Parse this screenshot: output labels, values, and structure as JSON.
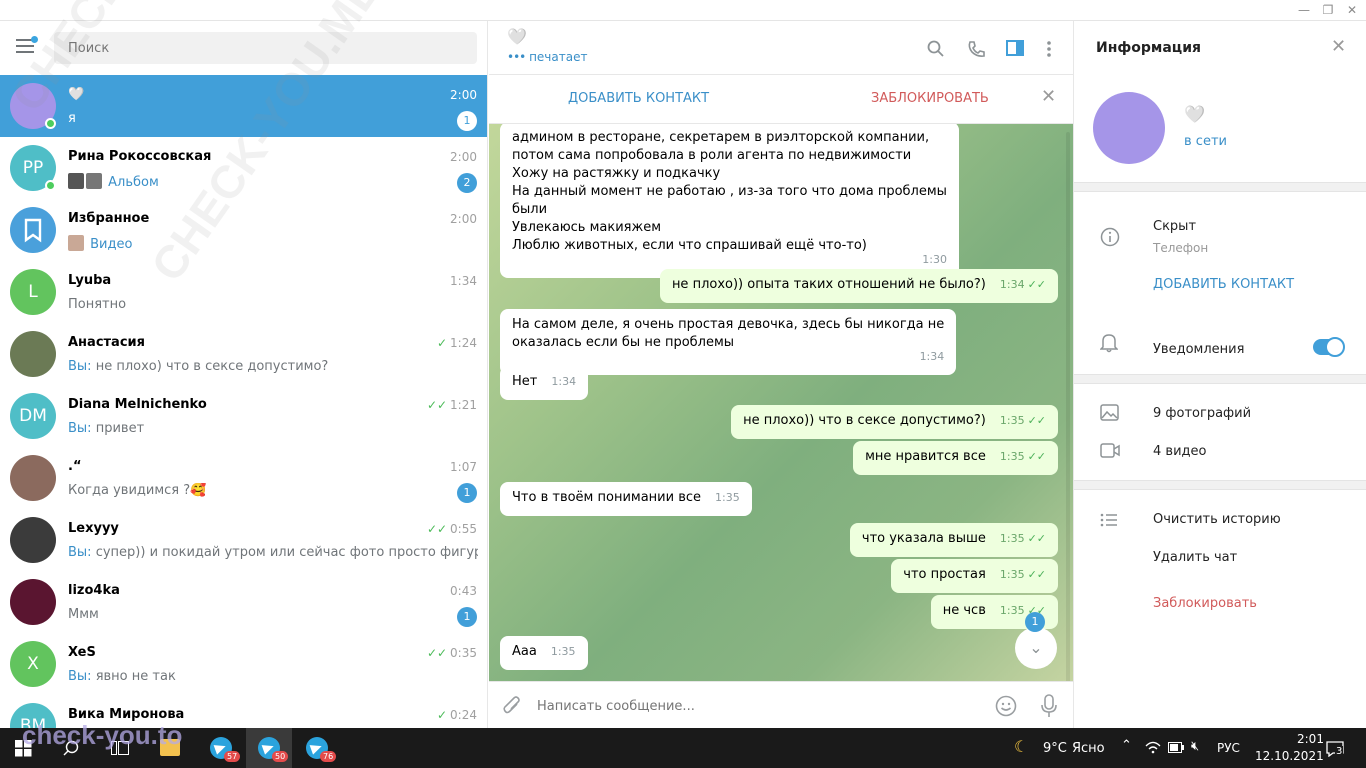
{
  "window": {
    "minimize": "—",
    "maximize": "❐",
    "close": "✕"
  },
  "search": {
    "placeholder": "Поиск"
  },
  "chats": [
    {
      "name": "🤍",
      "preview": "я",
      "time": "2:00",
      "badge": "1",
      "active": true,
      "avatar_color": "#a595e8",
      "initials": "",
      "online": true,
      "you": "",
      "media": "",
      "check": ""
    },
    {
      "name": "Рина Рокоссовская",
      "preview": "",
      "media": "Альбом",
      "time": "2:00",
      "badge": "2",
      "avatar_color": "#4fbec7",
      "initials": "РР",
      "online": true,
      "you": "",
      "check": ""
    },
    {
      "name": "Избранное",
      "preview": "",
      "media": "Видео",
      "time": "2:00",
      "badge": "",
      "avatar_color": "#4aa0db",
      "initials": "",
      "online": false,
      "you": "",
      "check": ""
    },
    {
      "name": "Lyuba",
      "preview": "Понятно",
      "time": "1:34",
      "badge": "",
      "avatar_color": "#62c45e",
      "initials": "L",
      "online": false,
      "you": "",
      "media": "",
      "check": ""
    },
    {
      "name": "Анастасия",
      "preview": "не плохо) что в сексе допустимо?",
      "you": "Вы:",
      "time": "1:24",
      "badge": "",
      "avatar_color": "#6b7a55",
      "initials": "",
      "online": false,
      "media": "",
      "check": "✓"
    },
    {
      "name": "Diana Melnichenko",
      "preview": "привет",
      "you": "Вы:",
      "time": "1:21",
      "badge": "",
      "avatar_color": "#4fbec7",
      "initials": "DM",
      "online": false,
      "media": "",
      "check": "✓✓"
    },
    {
      "name": ".“",
      "preview": "Когда увидимся ?🥰",
      "time": "1:07",
      "badge": "1",
      "avatar_color": "#8b6a5e",
      "initials": "",
      "online": false,
      "you": "",
      "media": "",
      "check": ""
    },
    {
      "name": "Lexyyy",
      "preview": "супер)) и покидай утром или сейчас фото просто фигуры, су...",
      "you": "Вы:",
      "time": "0:55",
      "badge": "",
      "avatar_color": "#3b3b3b",
      "initials": "",
      "online": false,
      "media": "",
      "check": "✓✓"
    },
    {
      "name": "lizo4ka",
      "preview": "Ммм",
      "time": "0:43",
      "badge": "1",
      "avatar_color": "#5a1530",
      "initials": "",
      "online": false,
      "you": "",
      "media": "",
      "check": ""
    },
    {
      "name": "XeS",
      "preview": "явно не так",
      "you": "Вы:",
      "time": "0:35",
      "badge": "",
      "avatar_color": "#62c45e",
      "initials": "X",
      "online": false,
      "media": "",
      "check": "✓✓"
    },
    {
      "name": "Вика Миронова",
      "preview": "",
      "time": "0:24",
      "badge": "",
      "avatar_color": "#4fbec7",
      "initials": "ВМ",
      "online": false,
      "you": "",
      "media": "",
      "check": "✓"
    }
  ],
  "chat_header": {
    "name": "🤍",
    "status": "печатает"
  },
  "chat_bar": {
    "add_contact": "ДОБАВИТЬ КОНТАКТ",
    "block": "ЗАБЛОКИРОВАТЬ"
  },
  "messages": [
    {
      "dir": "in",
      "lines": [
        "админом в ресторане, секретарем в риэлторской компании,",
        "потом сама попробовала в роли агента по недвижимости",
        "Хожу на растяжку и подкачку",
        "На данный момент не работаю , из-за того что дома проблемы",
        "были",
        "Увлекаюсь макияжем",
        "Люблю животных, если что спрашивай ещё что-то)"
      ],
      "time": "1:30"
    },
    {
      "dir": "out",
      "lines": [
        "не плохо)) опыта таких отношений не было?)"
      ],
      "time": "1:34"
    },
    {
      "dir": "in",
      "lines": [
        "На самом деле, я очень простая девочка, здесь бы никогда не",
        "оказалась если бы не проблемы"
      ],
      "time": "1:34"
    },
    {
      "dir": "in",
      "lines": [
        "Нет"
      ],
      "time": "1:34"
    },
    {
      "dir": "out",
      "lines": [
        "не плохо)) что в сексе допустимо?)"
      ],
      "time": "1:35"
    },
    {
      "dir": "out",
      "lines": [
        "мне нравится все"
      ],
      "time": "1:35"
    },
    {
      "dir": "in",
      "lines": [
        "Что в твоём понимании все"
      ],
      "time": "1:35"
    },
    {
      "dir": "out",
      "lines": [
        "что указала выше"
      ],
      "time": "1:35"
    },
    {
      "dir": "out",
      "lines": [
        "что простая"
      ],
      "time": "1:35"
    },
    {
      "dir": "out",
      "lines": [
        "не чсв"
      ],
      "time": "1:35"
    },
    {
      "dir": "in",
      "lines": [
        "Ааа"
      ],
      "time": "1:35"
    }
  ],
  "scroll_badge": "1",
  "composer": {
    "placeholder": "Написать сообщение..."
  },
  "info": {
    "title": "Информация",
    "name": "🤍",
    "status": "в сети",
    "phone_value": "Скрыт",
    "phone_label": "Телефон",
    "add_contact": "ДОБАВИТЬ КОНТАКТ",
    "notifications": "Уведомления",
    "notifications_on": true,
    "photos": "9 фотографий",
    "videos": "4 видео",
    "clear_history": "Очистить историю",
    "delete_chat": "Удалить чат",
    "block": "Заблокировать"
  },
  "taskbar": {
    "weather_temp": "9°C",
    "weather_text": "Ясно",
    "lang": "РУС",
    "time": "2:01",
    "date": "12.10.2021",
    "notif_count": "3",
    "tg_badges": [
      "57",
      "50",
      "76"
    ]
  },
  "watermark": {
    "main": "CHECK-YOU.ME",
    "tb": "check-you.to"
  },
  "colors": {
    "accent": "#419fd9",
    "online": "#4dcd5e",
    "danger": "#d15a5a",
    "link": "#3a8fc8"
  }
}
